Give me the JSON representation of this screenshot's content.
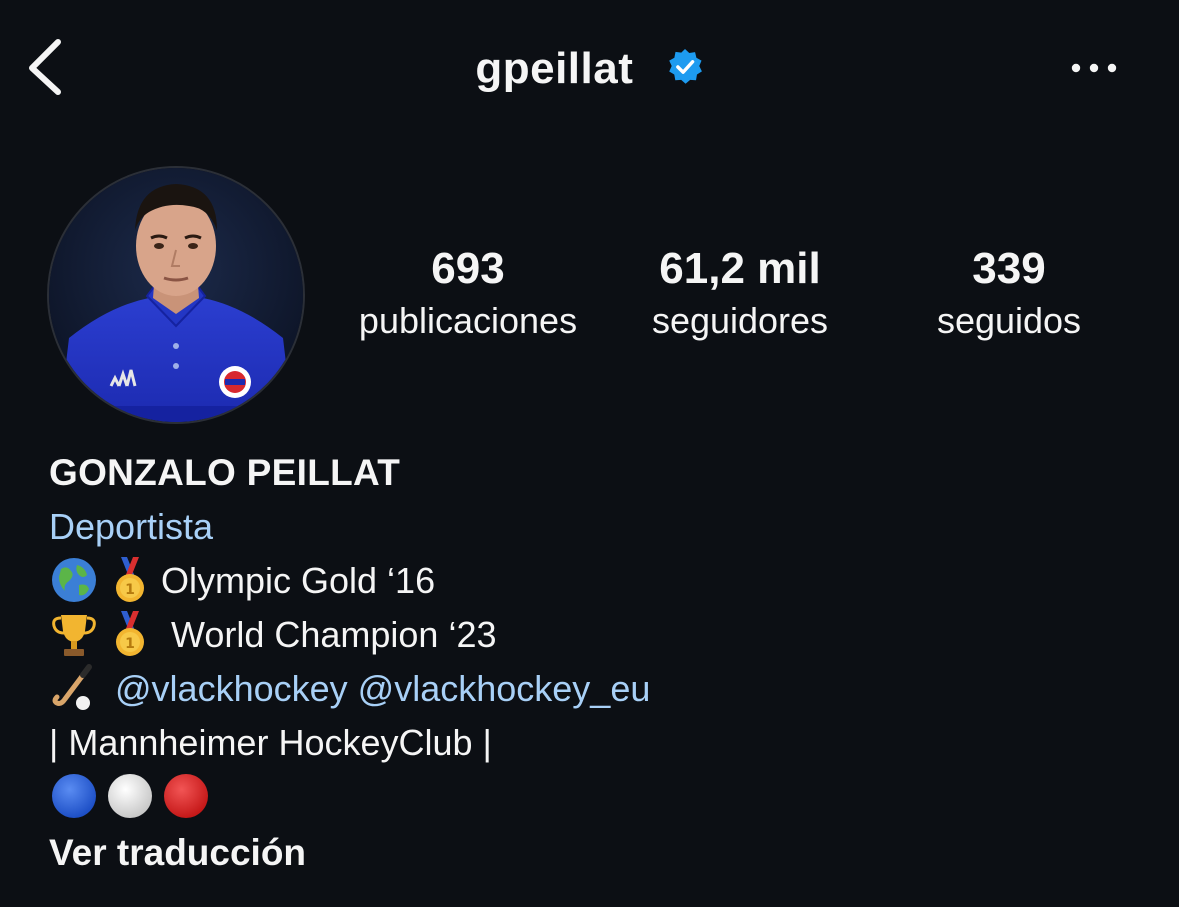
{
  "header": {
    "username": "gpeillat",
    "verified_icon": "verified-badge-icon",
    "back_icon": "chevron-left-icon",
    "more_icon": "more-horizontal-icon"
  },
  "profile": {
    "avatar_icon": "profile-avatar",
    "stats": {
      "posts": {
        "value": "693",
        "label": "publicaciones"
      },
      "followers": {
        "value": "61,2 mil",
        "label": "seguidores"
      },
      "following": {
        "value": "339",
        "label": "seguidos"
      }
    }
  },
  "bio": {
    "name": "GONZALO PEILLAT",
    "category": "Deportista",
    "line1_text": "Olympic Gold ‘16",
    "line2_text": " World Champion ‘23",
    "mention1": "@vlackhockey",
    "mention2": "@vlackhockey_eu",
    "line4_text": "| Mannheimer HockeyClub |",
    "translate_label": "Ver traducción"
  },
  "colors": {
    "background": "#0c0f14",
    "link": "#a8d0f7",
    "verified": "#1d9bf0",
    "text": "#f5f5f5"
  }
}
